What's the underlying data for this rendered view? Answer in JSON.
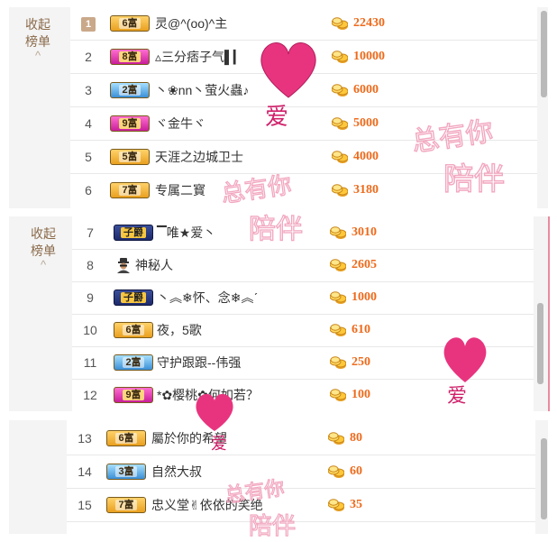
{
  "panels": [
    {
      "collapse": {
        "line1": "收起",
        "line2": "榜单",
        "arrow": "^"
      },
      "rows": [
        {
          "rank": "1",
          "vip": "6富",
          "vip_style": "gold",
          "name": "灵@^(oo)^主",
          "score": "22430"
        },
        {
          "rank": "2",
          "vip": "8富",
          "vip_style": "pink",
          "name": "▵三分痞子气▌▎",
          "score": "10000"
        },
        {
          "rank": "3",
          "vip": "2富",
          "vip_style": "blue",
          "name": "丶❀nn丶萤火蟲♪",
          "score": "6000"
        },
        {
          "rank": "4",
          "vip": "9富",
          "vip_style": "pink",
          "name": "ヾ金牛ヾ",
          "score": "5000"
        },
        {
          "rank": "5",
          "vip": "5富",
          "vip_style": "gold",
          "name": "天涯之边城卫士",
          "score": "4000"
        },
        {
          "rank": "6",
          "vip": "7富",
          "vip_style": "gold",
          "name": "专属二寳",
          "score": "3180"
        }
      ]
    },
    {
      "collapse": {
        "line1": "收起",
        "line2": "榜单",
        "arrow": "^"
      },
      "rows": [
        {
          "rank": "7",
          "vip": "子爵",
          "vip_style": "navy",
          "name": "▔唯★爱丶",
          "score": "3010"
        },
        {
          "rank": "8",
          "vip": "",
          "vip_style": "spy",
          "name": "神秘人",
          "score": "2605"
        },
        {
          "rank": "9",
          "vip": "子爵",
          "vip_style": "navy",
          "name": "丶︽❄怀、念❄︽ˊ",
          "score": "1000"
        },
        {
          "rank": "10",
          "vip": "6富",
          "vip_style": "gold",
          "name": "夜，5歌",
          "score": "610"
        },
        {
          "rank": "11",
          "vip": "2富",
          "vip_style": "blue",
          "name": "守护跟跟--伟强",
          "score": "250"
        },
        {
          "rank": "12",
          "vip": "9富",
          "vip_style": "pink",
          "name": "*✿樱桃✿何如若？",
          "score": "100"
        }
      ]
    },
    {
      "rows": [
        {
          "rank": "13",
          "vip": "6富",
          "vip_style": "gold",
          "name": "屬於你的希望",
          "score": "80"
        },
        {
          "rank": "14",
          "vip": "3富",
          "vip_style": "blue",
          "name": "自然大叔",
          "score": "60"
        },
        {
          "rank": "15",
          "vip": "7富",
          "vip_style": "gold",
          "name": "忠义堂✌依依的笑绝",
          "score": "35"
        }
      ]
    }
  ],
  "watermarks": {
    "text1": "总有你",
    "text2": "陪伴",
    "love": "爱"
  },
  "colors": {
    "score": "#ee6a1b",
    "heart": "#e8347f",
    "watermark": "#f2a7bf"
  },
  "icons": {
    "coin": "gold-coin-stack-icon",
    "spy": "mystery-person-icon",
    "heart": "heart-icon"
  }
}
